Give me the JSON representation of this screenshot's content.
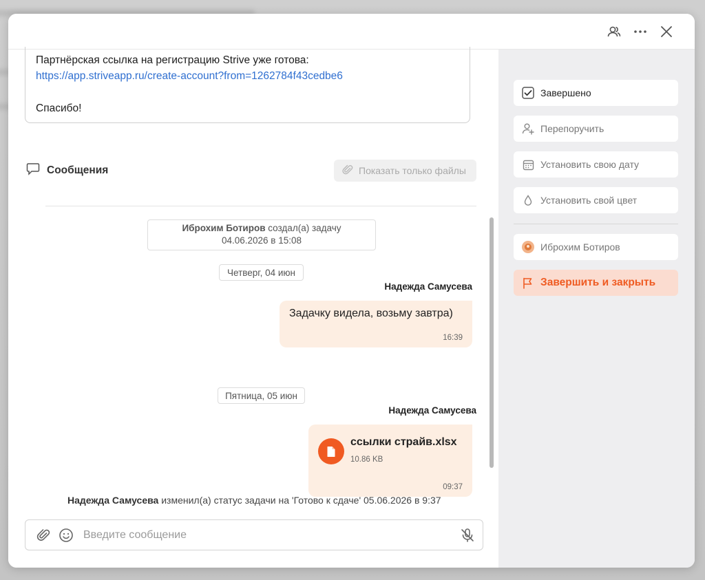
{
  "topbar": {
    "icons": [
      "participants-icon",
      "more-icon",
      "close-icon"
    ]
  },
  "description": {
    "line1": "Партнёрская ссылка на регистрацию Strive уже готова:",
    "link": "https://app.striveapp.ru/create-account?from=1262784f43cedbe6",
    "thanks": "Спасибо!"
  },
  "messages": {
    "title": "Сообщения",
    "files_only_label": "Показать только файлы"
  },
  "feed": {
    "created_author": "Иброхим Ботиров",
    "created_text": " создал(а) задачу",
    "created_time": "04.06.2026 в 15:08",
    "date1": "Четверг, 04 июн",
    "msg1_author": "Надежда Самусева",
    "msg1_text": "Задачку видела, возьму завтра)",
    "msg1_time": "16:39",
    "date2": "Пятница, 05 июн",
    "msg2_author": "Надежда Самусева",
    "file_name": "ссылки страйв.xlsx",
    "file_size": "10.86 KB",
    "msg2_time": "09:37",
    "status_author": "Надежда Самусева",
    "status_text": " изменил(а) статус задачи на 'Готово к сдаче' 05.06.2026 в 9:37"
  },
  "composer": {
    "placeholder": "Введите сообщение"
  },
  "sidebar": {
    "done_label": "Завершено",
    "reassign_label": "Перепоручить",
    "set_date_label": "Установить свою дату",
    "set_color_label": "Установить свой цвет",
    "assignee_label": "Иброхим Ботиров",
    "finish_label": "Завершить и закрыть"
  },
  "colors": {
    "accent": "#ef5b22",
    "bubble": "#fdeee2",
    "link": "#2f6fd0"
  }
}
